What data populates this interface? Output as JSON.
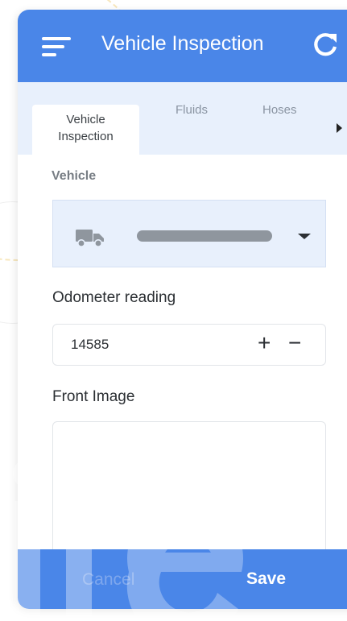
{
  "appbar": {
    "title": "Vehicle Inspection",
    "menu_icon": "menu-icon",
    "refresh_icon": "refresh-icon",
    "background": "#4a86e8"
  },
  "tabs": [
    {
      "label_line1": "Vehicle",
      "label_line2": "Inspection",
      "active": true
    },
    {
      "label": "Fluids",
      "active": false
    },
    {
      "label": "Hoses",
      "active": false
    }
  ],
  "tabs_more_icon": "chevron-right-icon",
  "form": {
    "vehicle": {
      "label": "Vehicle",
      "icon": "truck-icon",
      "dropdown_icon": "caret-down-icon"
    },
    "odometer": {
      "label": "Odometer reading",
      "value": "14585",
      "increment": "+",
      "decrement": "−"
    },
    "front_image": {
      "label": "Front Image"
    }
  },
  "footer": {
    "cancel_label": "Cancel",
    "save_label": "Save"
  },
  "colors": {
    "accent": "#4a86e8",
    "tab_bar": "#e8f0fc",
    "text": "#2b2f33"
  }
}
